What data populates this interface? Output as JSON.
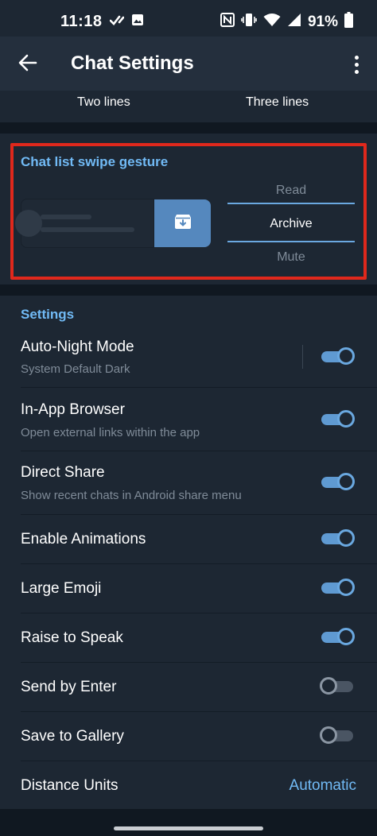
{
  "status_bar": {
    "time": "11:18",
    "battery_percent": "91%",
    "left_icons": [
      "missed-call-check-icon",
      "image-icon"
    ],
    "right_icons": [
      "nfc-icon",
      "vibrate-icon",
      "wifi-icon",
      "signal-icon",
      "battery-icon"
    ]
  },
  "app_bar": {
    "title": "Chat Settings",
    "back_icon": "arrow-left-icon",
    "menu_icon": "more-vert-icon"
  },
  "lines": {
    "two_lines": "Two lines",
    "three_lines": "Three lines"
  },
  "swipe": {
    "header": "Chat list swipe gesture",
    "options": [
      "Read",
      "Archive",
      "Mute"
    ],
    "selected": "Archive",
    "preview_icon": "archive-icon"
  },
  "settings": {
    "header": "Settings",
    "rows": [
      {
        "title": "Auto-Night Mode",
        "subtitle": "System Default Dark",
        "toggle": true
      },
      {
        "title": "In-App Browser",
        "subtitle": "Open external links within the app",
        "toggle": true
      },
      {
        "title": "Direct Share",
        "subtitle": "Show recent chats in Android share menu",
        "toggle": true
      },
      {
        "title": "Enable Animations",
        "toggle": true
      },
      {
        "title": "Large Emoji",
        "toggle": true
      },
      {
        "title": "Raise to Speak",
        "toggle": true
      },
      {
        "title": "Send by Enter",
        "toggle": false
      },
      {
        "title": "Save to Gallery",
        "toggle": false
      },
      {
        "title": "Distance Units",
        "value": "Automatic"
      }
    ]
  },
  "colors": {
    "accent": "#71baf5",
    "background": "#1d2733",
    "app_bar": "#242f3d",
    "highlight": "#e0281c"
  }
}
